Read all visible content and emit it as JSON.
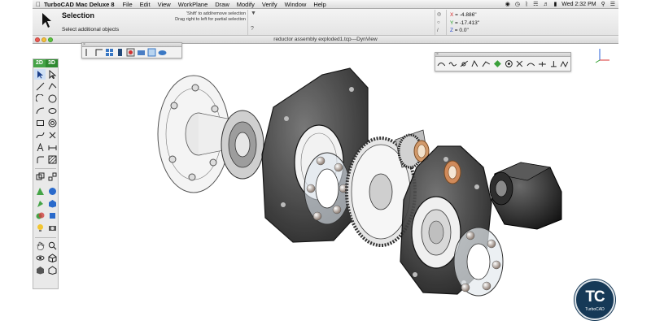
{
  "menubar": {
    "app_name": "TurboCAD Mac Deluxe 8",
    "items": [
      "File",
      "Edit",
      "View",
      "WorkPlane",
      "Draw",
      "Modify",
      "Verify",
      "Window",
      "Help"
    ],
    "clock": "Wed 2:32 PM"
  },
  "inspector": {
    "tool_name": "Selection",
    "status": "Select additional objects",
    "hint_lines": [
      "'Shift' to add/remove selection",
      "Drag right to left for partial selection"
    ],
    "coords": {
      "x_label": "X",
      "x_value": "-4.886\"",
      "y_label": "Y",
      "y_value": "-17.413\"",
      "z_label": "Z",
      "z_value": "0.0\""
    }
  },
  "document": {
    "title": "reductor assembly exploded1.tcp---DynView"
  },
  "palette": {
    "mode_2d": "2D",
    "mode_3d": "3D"
  },
  "colors": {
    "mode_2d": "#45a447",
    "badge": "#163957",
    "coord_x": "#d32020",
    "coord_y": "#1f9a1f",
    "coord_z": "#2244cc"
  },
  "badge": {
    "mark": "TC",
    "word": "TurboCAD"
  }
}
